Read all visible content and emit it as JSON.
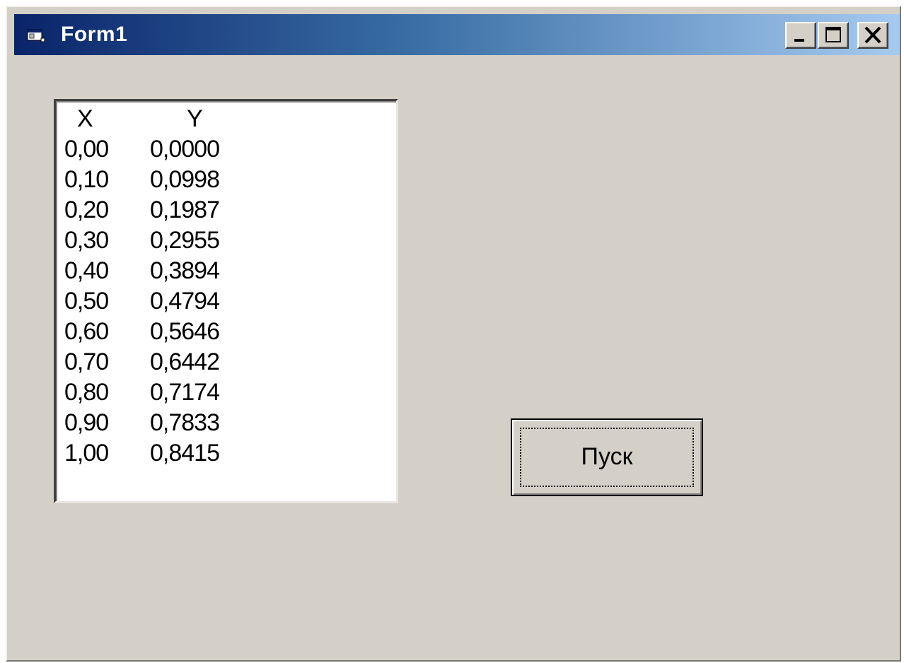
{
  "window": {
    "title": "Form1",
    "icon": "form-window-icon",
    "controls": [
      "minimize-icon",
      "maximize-icon",
      "close-icon"
    ]
  },
  "listbox": {
    "header": {
      "x": "X",
      "y": "Y"
    },
    "rows": [
      {
        "x": "0,00",
        "y": "0,0000"
      },
      {
        "x": "0,10",
        "y": "0,0998"
      },
      {
        "x": "0,20",
        "y": "0,1987"
      },
      {
        "x": "0,30",
        "y": "0,2955"
      },
      {
        "x": "0,40",
        "y": "0,3894"
      },
      {
        "x": "0,50",
        "y": "0,4794"
      },
      {
        "x": "0,60",
        "y": "0,5646"
      },
      {
        "x": "0,70",
        "y": "0,6442"
      },
      {
        "x": "0,80",
        "y": "0,7174"
      },
      {
        "x": "0,90",
        "y": "0,7833"
      },
      {
        "x": "1,00",
        "y": "0,8415"
      }
    ]
  },
  "start_button": {
    "label": "Пуск"
  },
  "colors": {
    "window_bg": "#d4d0c8",
    "titlebar_start": "#0a246a",
    "titlebar_end": "#a6caf0",
    "title_text": "#ffffff"
  }
}
